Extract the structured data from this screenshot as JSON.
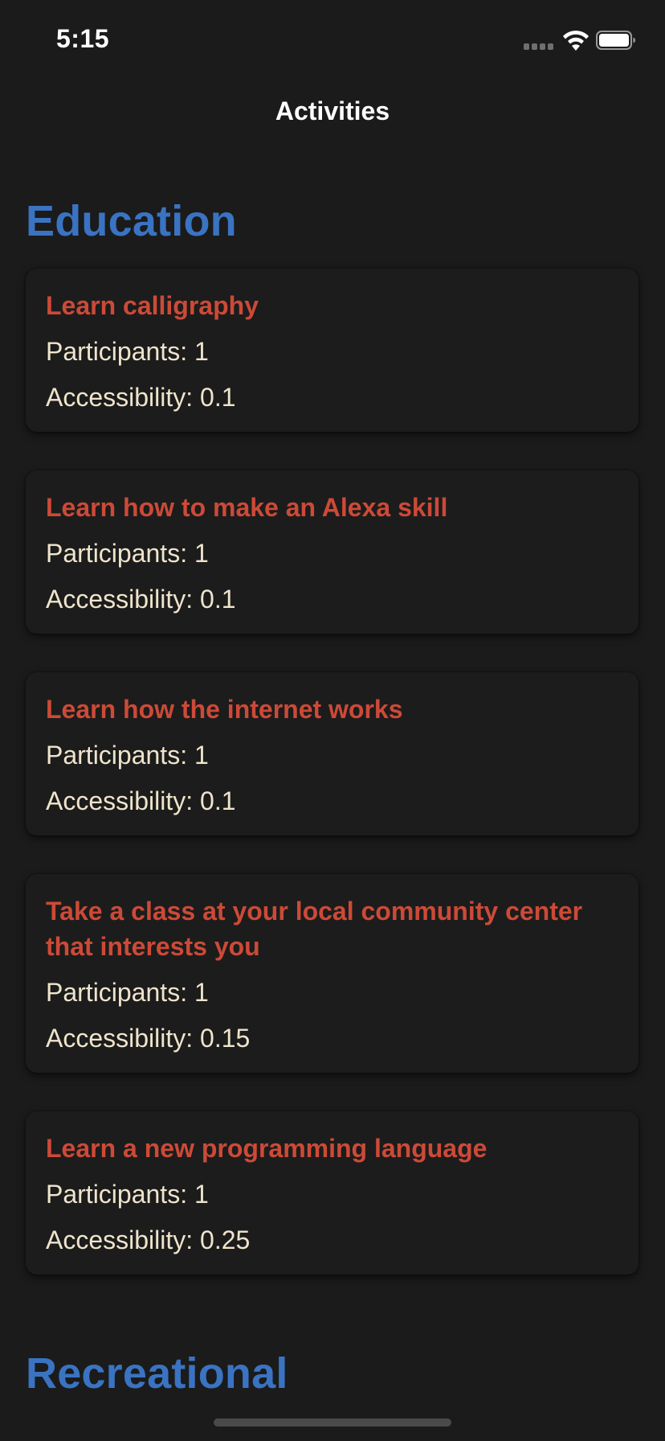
{
  "status_bar": {
    "time": "5:15",
    "icons": [
      "cellular-signal-icon",
      "wifi-icon",
      "battery-icon"
    ]
  },
  "nav": {
    "title": "Activities"
  },
  "colors": {
    "background": "#1b1b1b",
    "section_header": "#3a73c2",
    "card_title": "#cc4a37",
    "card_text": "#efe4cc"
  },
  "sections": [
    {
      "title": "Education",
      "activities": [
        {
          "title": "Learn calligraphy",
          "participants": "Participants: 1",
          "accessibility": "Accessibility: 0.1"
        },
        {
          "title": "Learn how to make an Alexa skill",
          "participants": "Participants: 1",
          "accessibility": "Accessibility: 0.1"
        },
        {
          "title": "Learn how the internet works",
          "participants": "Participants: 1",
          "accessibility": "Accessibility: 0.1"
        },
        {
          "title": "Take a class at your local community center that interests you",
          "participants": "Participants: 1",
          "accessibility": "Accessibility: 0.15"
        },
        {
          "title": "Learn a new programming language",
          "participants": "Participants: 1",
          "accessibility": "Accessibility: 0.25"
        }
      ]
    },
    {
      "title": "Recreational",
      "activities": []
    }
  ]
}
